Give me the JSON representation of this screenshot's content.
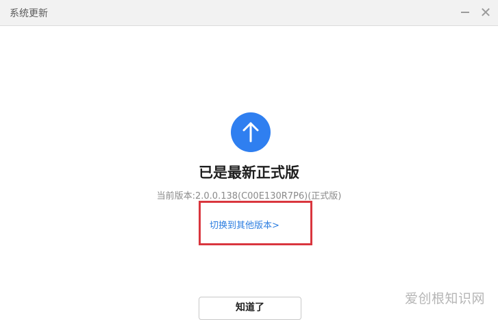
{
  "window": {
    "title": "系统更新",
    "minimize_icon": "minimize-icon",
    "close_icon": "close-icon",
    "close_glyph": "✕"
  },
  "main": {
    "icon": "arrow-up-icon",
    "icon_color": "#2f7ff0",
    "headline": "已是最新正式版",
    "current_version": "当前版本:2.0.0.138(C00E130R7P6)(正式版)",
    "switch_link": "切换到其他版本>",
    "link_color": "#2b7de0",
    "highlight_color": "#d9363e",
    "ok_button": "知道了"
  },
  "watermark": {
    "text": "爱创根知识网"
  }
}
